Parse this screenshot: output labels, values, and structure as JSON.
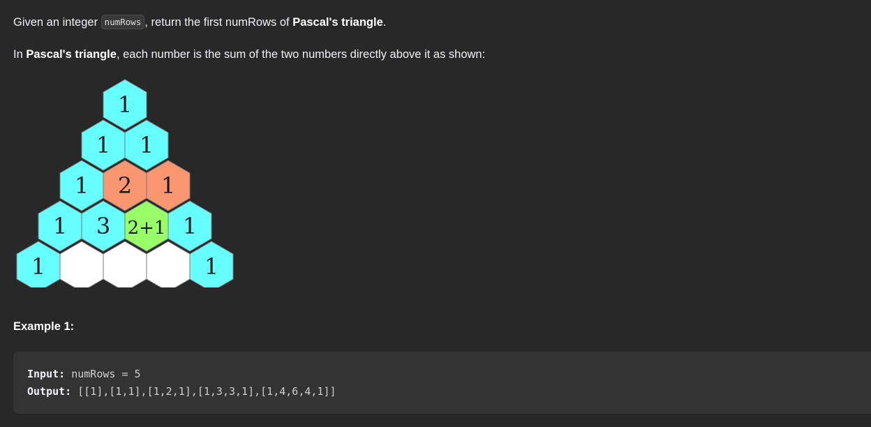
{
  "problem": {
    "intro_prefix": "Given an integer ",
    "intro_code": "numRows",
    "intro_middle": ", return the first numRows of ",
    "intro_bold": "Pascal's triangle",
    "intro_suffix": ".",
    "rule_prefix": "In ",
    "rule_bold": "Pascal's triangle",
    "rule_suffix": ", each number is the sum of the two numbers directly above it as shown:"
  },
  "figure": {
    "rows": [
      [
        {
          "text": "1",
          "color": "cyan"
        }
      ],
      [
        {
          "text": "1",
          "color": "cyan"
        },
        {
          "text": "1",
          "color": "cyan"
        }
      ],
      [
        {
          "text": "1",
          "color": "cyan"
        },
        {
          "text": "2",
          "color": "orange"
        },
        {
          "text": "1",
          "color": "orange"
        }
      ],
      [
        {
          "text": "1",
          "color": "cyan"
        },
        {
          "text": "3",
          "color": "cyan"
        },
        {
          "text": "2+1",
          "color": "green"
        },
        {
          "text": "1",
          "color": "cyan"
        }
      ],
      [
        {
          "text": "1",
          "color": "cyan"
        },
        {
          "text": "",
          "color": "white"
        },
        {
          "text": "",
          "color": "white"
        },
        {
          "text": "",
          "color": "white"
        },
        {
          "text": "1",
          "color": "cyan"
        }
      ]
    ],
    "colors": {
      "cyan": "#66ffff",
      "orange": "#fa9770",
      "green": "#99ff66",
      "white": "#ffffff"
    }
  },
  "example": {
    "title": "Example 1:",
    "input_label": "Input:",
    "input_value": " numRows = 5",
    "output_label": "Output:",
    "output_value": " [[1],[1,1],[1,2,1],[1,3,3,1],[1,4,6,4,1]]"
  }
}
